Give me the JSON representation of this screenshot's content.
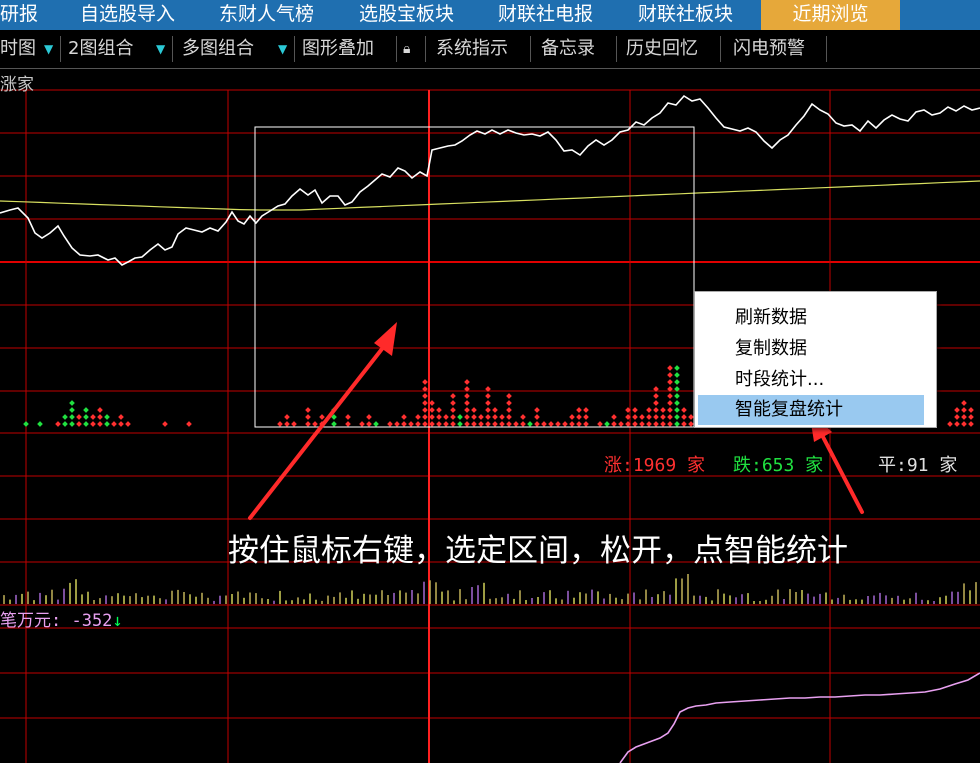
{
  "tabs": [
    {
      "label": "研报"
    },
    {
      "label": "自选股导入"
    },
    {
      "label": "东财人气榜"
    },
    {
      "label": "选股宝板块"
    },
    {
      "label": "财联社电报"
    },
    {
      "label": "财联社板块"
    },
    {
      "label": "近期浏览"
    }
  ],
  "toolbar": {
    "items": [
      "时图",
      "2图组合",
      "多图组合",
      "图形叠加",
      "系统指示",
      "备忘录",
      "历史回忆",
      "闪电预警"
    ]
  },
  "chart": {
    "top_label": "涨家"
  },
  "context_menu": {
    "items": [
      "刷新数据",
      "复制数据",
      "时段统计...",
      "智能复盘统计"
    ],
    "highlighted": "智能复盘统计"
  },
  "stats": {
    "up": "涨:1969 家",
    "down": "跌:653 家",
    "flat": "平:91 家"
  },
  "annotation": "按住鼠标右键，选定区间，松开，点智能统计",
  "indicator": {
    "label": "笔万元: -352",
    "arrow": "↓"
  },
  "colors": {
    "tab_bar": "#1f6fb0",
    "tab_active": "#e6a83a",
    "grid_red": "#c00000",
    "line_white": "#ffffff",
    "avg_line": "#d8e060",
    "up": "#ff3030",
    "down": "#20e040",
    "flat": "#e0e0e0",
    "menu_highlight": "#99c9f0",
    "indicator_line": "#e8a0f0"
  }
}
